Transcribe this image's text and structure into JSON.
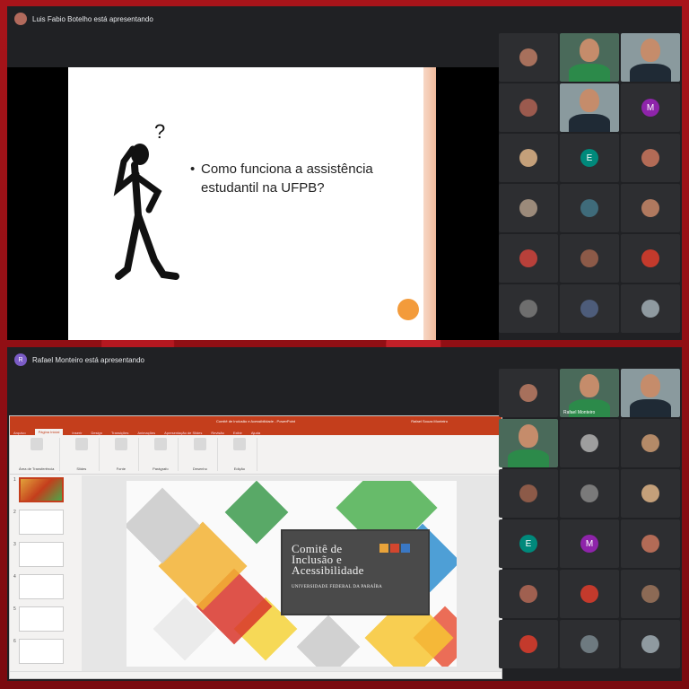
{
  "top_panel": {
    "presenter": "Luis Fabio Botelho está apresentando",
    "slide": {
      "bullet": "Como funciona a assistência estudantil na UFPB?"
    },
    "participants": [
      {
        "type": "avatar",
        "color": "#a7705c"
      },
      {
        "type": "video",
        "label": ""
      },
      {
        "type": "video",
        "label": ""
      },
      {
        "type": "avatar",
        "color": "#9b5a4e"
      },
      {
        "type": "video",
        "label": ""
      },
      {
        "type": "letter",
        "letter": "M",
        "color": "#8e24aa"
      },
      {
        "type": "avatar",
        "color": "#c4a07a"
      },
      {
        "type": "letter",
        "letter": "E",
        "color": "#00897b"
      },
      {
        "type": "avatar",
        "color": "#b36b56"
      },
      {
        "type": "avatar",
        "color": "#9b8a7a"
      },
      {
        "type": "avatar",
        "color": "#3f6b7a"
      },
      {
        "type": "avatar",
        "color": "#b0795f"
      },
      {
        "type": "avatar",
        "color": "#b8403a"
      },
      {
        "type": "avatar",
        "color": "#8c5a48"
      },
      {
        "type": "avatar",
        "color": "#c43a2c"
      },
      {
        "type": "avatar",
        "color": "#6e6e6e"
      },
      {
        "type": "avatar",
        "color": "#4d5c7a"
      },
      {
        "type": "avatar",
        "color": "#8f9aa0"
      }
    ]
  },
  "bottom_panel": {
    "presenter_initial": "R",
    "presenter": "Rafael Monteiro está apresentando",
    "ppt": {
      "window_title": "Comitê de Inclusão e Acessibilidade - PowerPoint",
      "user": "Rafael Souza Monteiro",
      "tabs": [
        "Arquivo",
        "Página Inicial",
        "Inserir",
        "Design",
        "Transições",
        "Animações",
        "Apresentação de Slides",
        "Revisão",
        "Exibir",
        "Ajuda"
      ],
      "ribbon_groups": [
        "Área de Transferência",
        "Slides",
        "Fonte",
        "Parágrafo",
        "Desenho",
        "Edição"
      ],
      "thumbnail_numbers": [
        "1",
        "2",
        "3",
        "4",
        "5",
        "6"
      ],
      "slide": {
        "title_lines": [
          "Comitê de",
          "Inclusão e",
          "Acessibilidade"
        ],
        "subtitle": "UNIVERSIDADE FEDERAL DA PARAÍBA"
      }
    },
    "participants": [
      {
        "type": "avatar",
        "color": "#a7705c"
      },
      {
        "type": "video",
        "label": "Rafael Monteiro"
      },
      {
        "type": "video",
        "label": ""
      },
      {
        "type": "video",
        "label": ""
      },
      {
        "type": "avatar",
        "color": "#9e9e9e"
      },
      {
        "type": "avatar",
        "color": "#b48a68"
      },
      {
        "type": "avatar",
        "color": "#8c5a48"
      },
      {
        "type": "avatar",
        "color": "#7a7a7a"
      },
      {
        "type": "avatar",
        "color": "#c4a07a"
      },
      {
        "type": "letter",
        "letter": "E",
        "color": "#00897b"
      },
      {
        "type": "letter",
        "letter": "M",
        "color": "#8e24aa"
      },
      {
        "type": "avatar",
        "color": "#b36b56"
      },
      {
        "type": "avatar",
        "color": "#a06050"
      },
      {
        "type": "avatar",
        "color": "#c43a2c"
      },
      {
        "type": "avatar",
        "color": "#8c6a55"
      },
      {
        "type": "avatar",
        "color": "#c43a2c"
      },
      {
        "type": "avatar",
        "color": "#6e7a80"
      },
      {
        "type": "avatar",
        "color": "#8f9aa0"
      }
    ]
  }
}
